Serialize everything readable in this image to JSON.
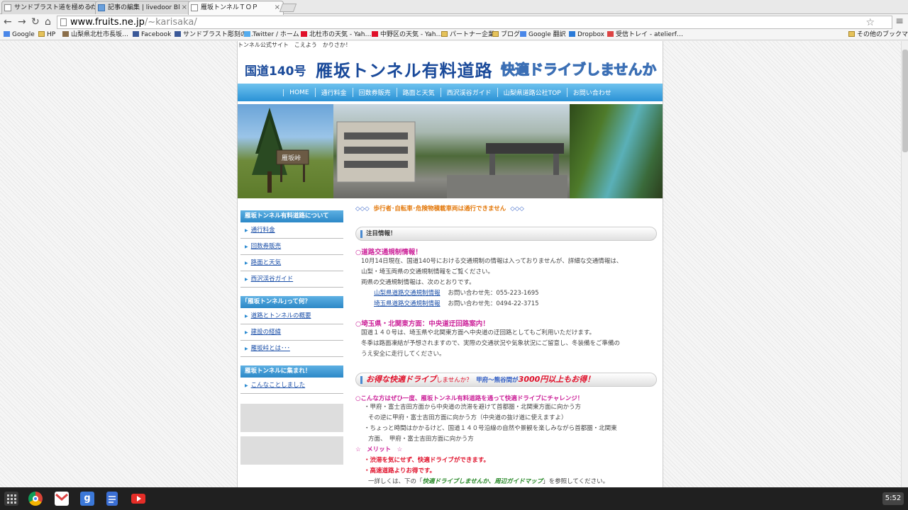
{
  "browser": {
    "tabs": [
      {
        "title": "サンドブラスト道を極めるため"
      },
      {
        "title": "記事の編集 | livedoor Bl"
      },
      {
        "title": "雁坂トンネルＴＯＰ"
      }
    ],
    "url_domain": "www.fruits.ne.jp",
    "url_path": "/~karisaka/",
    "bookmarks": [
      "Google",
      "HP",
      "山梨県北杜市長坂…",
      "Facebook",
      "サンドブラスト彫刻の…",
      "Twitter / ホーム",
      "北杜市の天気 - Yah…",
      "中野区の天気 - Yah…",
      "パートナー企業",
      "ブログ",
      "Google 翻訳",
      "Dropbox",
      "受信トレイ - atelierf…"
    ],
    "other_bookmarks": "その他のブックマーク"
  },
  "site": {
    "tagline": "トンネル公式サイト　こえよう　かりさか！",
    "route": "国道140号",
    "name": "雁坂トンネル有料道路",
    "slogan": "快適ドライブしませんか",
    "nav": [
      "HOME",
      "通行料金",
      "回数券販売",
      "路面と天気",
      "西沢渓谷ガイド",
      "山梨県道路公社TOP",
      "お問い合わせ"
    ],
    "sidebar": [
      {
        "title": "雁坂トンネル有料道路について",
        "items": [
          "通行料金",
          "回数券販売",
          "路面と天気",
          "西沢渓谷ガイド"
        ]
      },
      {
        "title": "｢雁坂トンネル｣って何？",
        "items": [
          "道路とトンネルの概要",
          "建設の経緯",
          "雁坂峠とは･･･"
        ]
      },
      {
        "title": "雁坂トンネルに集まれ！",
        "items": [
          "こんなことしました"
        ]
      }
    ],
    "banner_sign": "雁坂峠"
  },
  "main": {
    "warning_prefix": "◇◇◇",
    "warning": "歩行者･自転車･危険物積載車両は通行できません",
    "warning_suffix": "◇◇◇",
    "notice_title": "注目情報！",
    "traffic_title": "○道路交通規制情報！",
    "traffic_p1": "10月14日現在、国道140号における交通規制の情報は入っておりませんが、詳細な交通情報は、",
    "traffic_p2": "山梨・埼玉両県の交通規制情報をご覧ください。",
    "traffic_p3": "両県の交通規制情報は、次のとおりです。",
    "link1": "山梨県道路交通規制情報",
    "link1_tel": "お問い合わせ先：055-223-1695",
    "link2": "埼玉県道路交通規制情報",
    "link2_tel": "お問い合わせ先：0494-22-3715",
    "saitama_title": "○埼玉県・北関東方面：中央道迂回路案内！",
    "saitama_p1": "国道１４０号は、埼玉県や北関東方面へ中央道の迂回路としてもご利用いただけます。",
    "saitama_p2": "冬季は路面凍結が予想されますので、実際の交通状況や気象状況にご留意し、冬装備をご準備の",
    "saitama_p3": "うえ安全に走行してください。",
    "promo_a": "お得な快適ドライブ",
    "promo_b": "しませんか？",
    "promo_c": "甲府～熊谷間が",
    "promo_d": "3000円以上もお得！",
    "challenge_title": "○こんな方はぜひ一度、雁坂トンネル有料道路を通って快適ドライブにチャレンジ！",
    "challenge_1": "・甲府・富士吉田方面から中央道の渋滞を避けて首都圏・北関東方面に向かう方",
    "challenge_2": "その逆に甲府・富士吉田方面に向かう方（中央道の抜け道に使えますよ）",
    "challenge_3": "・ちょっと時間はかかるけど、国道１４０号沿線の自然や景観を楽しみながら首都圏・北関東",
    "challenge_4": "方面、　甲府・富士吉田方面に向かう方",
    "merit_title": "☆　メリット　☆",
    "merit_1": "・渋滞を気にせず、快適ドライブができます。",
    "merit_2": "・高速道路よりお得です。",
    "detail_pre": "一詳しくは、下の「",
    "detail_link": "快適ドライブしませんか、周辺ガイドマップ",
    "detail_post": "」を参照してください。"
  },
  "taskbar": {
    "clock": "5:52"
  }
}
